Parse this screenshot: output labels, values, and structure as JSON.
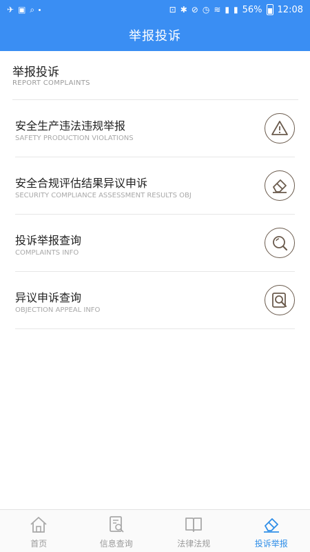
{
  "status_bar": {
    "battery_percent": "56%",
    "time": "12:08"
  },
  "app_bar": {
    "title": "举报投诉"
  },
  "section": {
    "title": "举报投诉",
    "subtitle": "REPORT COMPLAINTS"
  },
  "items": [
    {
      "title": "安全生产违法违规举报",
      "subtitle": "SAFETY PRODUCTION VIOLATIONS",
      "icon": "warning-icon"
    },
    {
      "title": "安全合规评估结果异议申诉",
      "subtitle": "SECURITY COMPLIANCE ASSESSMENT RESULTS OBJ",
      "icon": "eraser-icon"
    },
    {
      "title": "投诉举报查询",
      "subtitle": "COMPLAINTS INFO",
      "icon": "search-icon"
    },
    {
      "title": "异议申诉查询",
      "subtitle": "OBJECTION APPEAL INFO",
      "icon": "doc-search-icon"
    }
  ],
  "bottom_nav": {
    "items": [
      {
        "label": "首页",
        "icon": "home-icon",
        "active": false
      },
      {
        "label": "信息查询",
        "icon": "info-search-icon",
        "active": false
      },
      {
        "label": "法律法规",
        "icon": "book-icon",
        "active": false
      },
      {
        "label": "投诉举报",
        "icon": "report-icon",
        "active": true
      }
    ]
  },
  "colors": {
    "primary": "#3a8ef3",
    "active_tab": "#2f8ee8",
    "icon_stroke": "#6a5a4c"
  }
}
